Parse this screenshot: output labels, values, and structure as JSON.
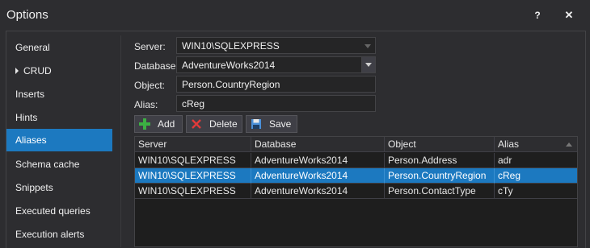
{
  "window": {
    "title": "Options",
    "help_label": "?",
    "close_label": "✕"
  },
  "sidebar": {
    "items": [
      {
        "label": "General"
      },
      {
        "label": "CRUD"
      },
      {
        "label": "Inserts"
      },
      {
        "label": "Hints"
      },
      {
        "label": "Aliases",
        "selected": true
      },
      {
        "label": "Schema cache"
      },
      {
        "label": "Snippets"
      },
      {
        "label": "Executed queries"
      },
      {
        "label": "Execution alerts"
      }
    ]
  },
  "form": {
    "server_label": "Server:",
    "server_value": "WIN10\\SQLEXPRESS",
    "database_label": "Database:",
    "database_value": "AdventureWorks2014",
    "object_label": "Object:",
    "object_value": "Person.CountryRegion",
    "alias_label": "Alias:",
    "alias_value": "cReg"
  },
  "toolbar": {
    "add_label": "Add",
    "delete_label": "Delete",
    "save_label": "Save"
  },
  "grid": {
    "columns": [
      "Server",
      "Database",
      "Object",
      "Alias"
    ],
    "rows": [
      [
        "WIN10\\SQLEXPRESS",
        "AdventureWorks2014",
        "Person.Address",
        "adr"
      ],
      [
        "WIN10\\SQLEXPRESS",
        "AdventureWorks2014",
        "Person.CountryRegion",
        "cReg"
      ],
      [
        "WIN10\\SQLEXPRESS",
        "AdventureWorks2014",
        "Person.ContactType",
        "cTy"
      ]
    ],
    "selected_row": 1
  },
  "colors": {
    "accent": "#1c79c0",
    "add_icon": "#3cb043",
    "delete_icon": "#e03a3a",
    "save_icon": "#4a90d9"
  }
}
